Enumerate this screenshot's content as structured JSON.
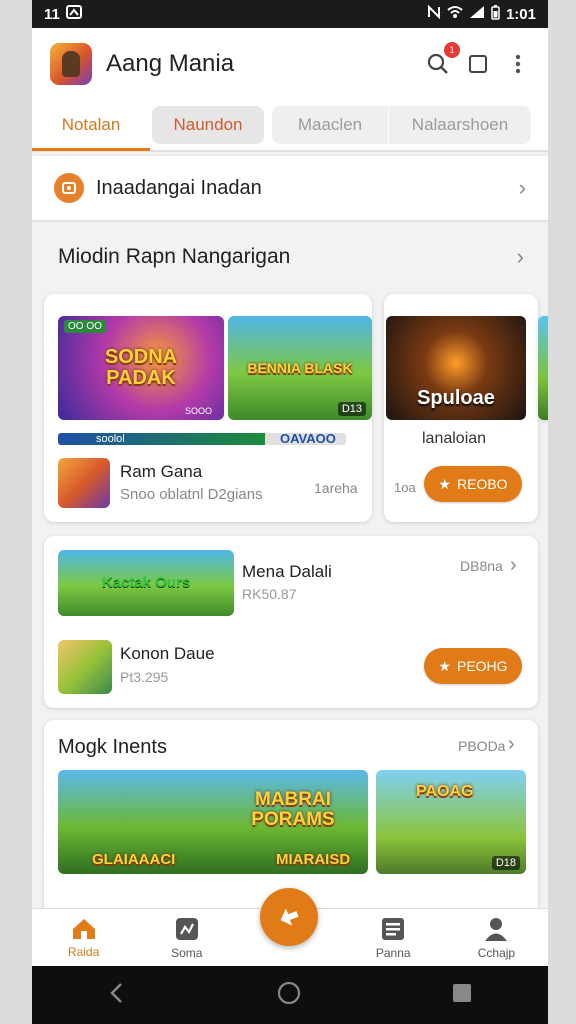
{
  "status_bar": {
    "left_text": "11",
    "time": "1:01"
  },
  "app_bar": {
    "title": "Aang Mania",
    "badge_text": ""
  },
  "tabs": [
    {
      "label": "Notalan",
      "state": "active"
    },
    {
      "label": "Naundon",
      "state": "pill"
    },
    {
      "label": "Maaclen",
      "state": "light"
    },
    {
      "label": "Nalaarshoen",
      "state": "light"
    }
  ],
  "quick_row": {
    "label": "Inaadangai Inadan"
  },
  "section1": {
    "title": "Miodin Rapn Nangarigan"
  },
  "featured_card": {
    "thumb1_title": "SODNA PADAK",
    "thumb1_tag": "OO OO",
    "thumb1_sub": "SOOO",
    "thumb2_title": "BENNIA BLASK",
    "thumb2_count": "D13",
    "progress_left_label": "soolol",
    "progress_right_label": "OAVAOO",
    "progress_value": 0.72,
    "item_title": "Ram Gana",
    "item_subtitle": "Snoo oblatnl D2gians",
    "item_meta": "1areha"
  },
  "side_card": {
    "thumb_title": "Spuloae",
    "caption": "lanaloian",
    "meta": "1oa",
    "button_label": "REOBO"
  },
  "card2": {
    "thumb_title": "Kactak Ours",
    "row1_title": "Mena Dalali",
    "row1_sub": "RK50.87",
    "row1_meta": "DB8na",
    "row2_title": "Konon Daue",
    "row2_sub": "Pt3.295",
    "button_label": "PEOHG"
  },
  "section3": {
    "title": "Mogk Inents",
    "link_label": "PBODa",
    "thumb1_title": "MABRAI PORAMS",
    "thumb1_footer_left": "GLAIAAACI",
    "thumb1_footer_right": "MIARAISD",
    "thumb2_title": "PAOAG",
    "thumb2_count": "D18"
  },
  "bottom_nav": [
    {
      "label": "Raida",
      "icon": "home-icon",
      "active": true
    },
    {
      "label": "Soma",
      "icon": "map-icon",
      "active": false
    },
    {
      "label": "Panna",
      "icon": "list-icon",
      "active": false
    },
    {
      "label": "Cchajp",
      "icon": "person-icon",
      "active": false
    }
  ],
  "colors": {
    "accent": "#e07b18",
    "tab_active": "#d27a1c"
  }
}
